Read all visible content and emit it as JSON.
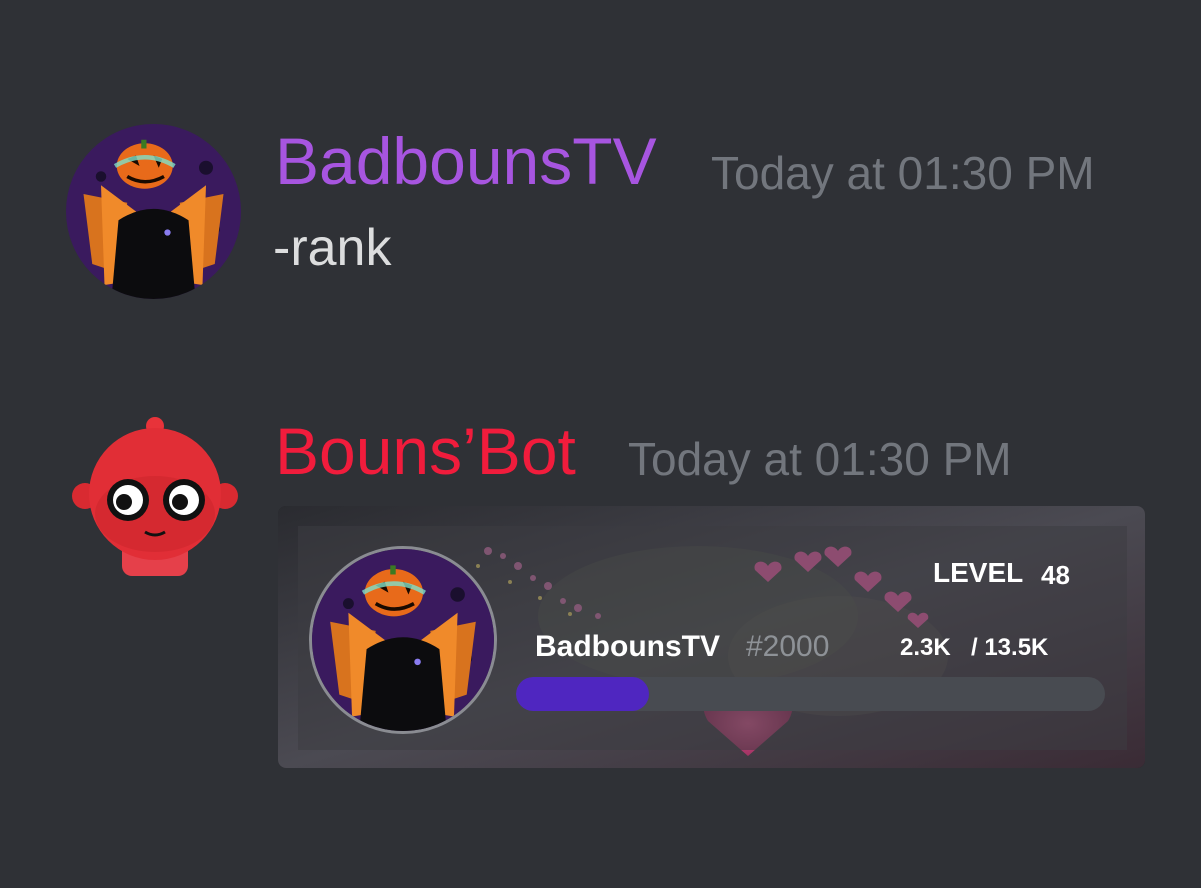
{
  "messages": [
    {
      "username": "BadbounsTV",
      "username_color": "#a755e0",
      "timestamp": "Today at 01:30 PM",
      "content": "-rank",
      "avatar_icon": "pumpkin-head-avatar-icon"
    },
    {
      "username": "Bouns’Bot",
      "username_color": "#f11c3c",
      "timestamp": "Today at 01:30 PM",
      "avatar_icon": "red-robot-avatar-icon"
    }
  ],
  "rank_card": {
    "level_label": "LEVEL",
    "level_value": "48",
    "username": "BadbounsTV",
    "discriminator": "#2000",
    "xp_current": "2.3K",
    "xp_required": "/ 13.5K",
    "progress_fraction": 0.17,
    "progress_color": "#4f26c0",
    "avatar_icon": "pumpkin-head-avatar-icon"
  },
  "colors": {
    "background": "#2f3136",
    "timestamp": "#72767d",
    "message_text": "#dcddde"
  }
}
